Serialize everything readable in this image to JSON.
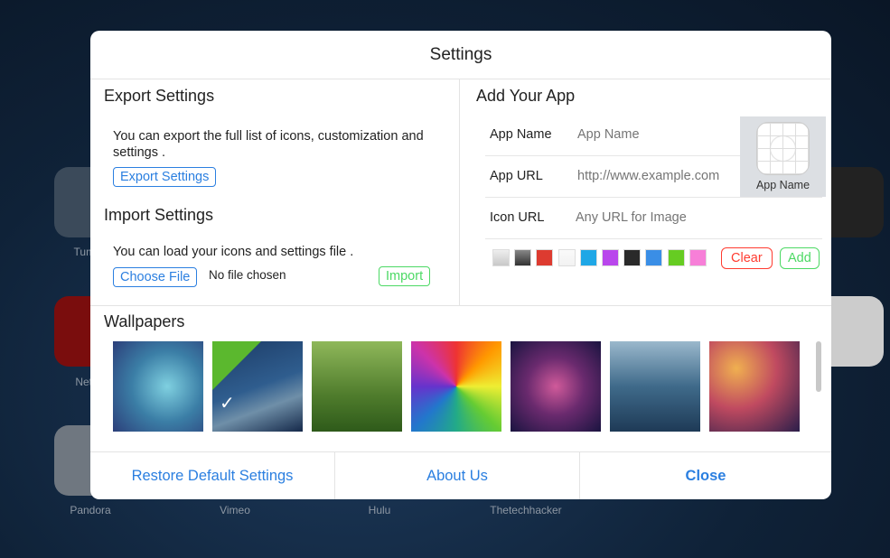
{
  "background": {
    "apps": [
      {
        "label": "Tumblr"
      },
      {
        "label": "Netflix"
      },
      {
        "label": "Pandora"
      },
      {
        "label": "Vimeo"
      },
      {
        "label": "Hulu"
      },
      {
        "label": "Thetechhacker"
      }
    ]
  },
  "modal": {
    "title": "Settings",
    "export": {
      "heading": "Export Settings",
      "text": "You can export the full list of icons, customization and settings .",
      "button": "Export Settings"
    },
    "import": {
      "heading": "Import Settings",
      "text": "You can load your icons and settings file .",
      "choose_button": "Choose File",
      "file_status": "No file chosen",
      "import_button": "Import"
    },
    "add_app": {
      "heading": "Add Your App",
      "fields": [
        {
          "label": "App Name",
          "placeholder": "App Name"
        },
        {
          "label": "App URL",
          "placeholder": "http://www.example.com"
        },
        {
          "label": "Icon URL",
          "placeholder": "Any URL for Image"
        }
      ],
      "preview_label": "App Name",
      "colors": [
        "#c8c8c8",
        "#4a4a4a",
        "#dd3b30",
        "#f2f2f2",
        "#1fa7e6",
        "#b946ec",
        "#2a2a2a",
        "#3a8ee6",
        "#66cc22",
        "#f77fd8"
      ],
      "clear_button": "Clear",
      "add_button": "Add",
      "clear_color": "#ff3b30",
      "add_color": "#4cd964"
    },
    "wallpapers": {
      "heading": "Wallpapers",
      "selected_index": 1,
      "items": [
        "radial-gradient(circle at 60% 50%,#7fd0e0,#3b7ea6 50%,#2c3f7a)",
        "linear-gradient(160deg,#1c3b66,#2f5d8e 50%,#6f8fa8 70%,#15294a)",
        "linear-gradient(180deg,#8fb85a,#4f7c2c 60%,#2e5a1a)",
        "conic-gradient(#e33,#f90,#ee3,#6c3,#2a8,#27c,#63c,#c3a,#e33)",
        "radial-gradient(circle at 50% 50%,#d05a9a,#6a2a6e 45%,#1a1440)",
        "linear-gradient(180deg,#9ab8cc,#3f6a8a 50%,#1e3a56)",
        "radial-gradient(circle at 30% 30%,#f0b050,#c04a60 45%,#2a1e4a)"
      ]
    },
    "footer": {
      "restore": "Restore Default Settings",
      "about": "About Us",
      "close": "Close"
    }
  }
}
